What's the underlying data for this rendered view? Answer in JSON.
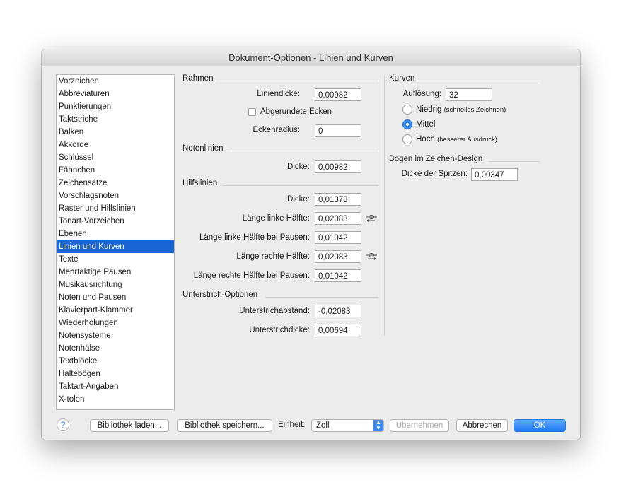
{
  "window": {
    "title": "Dokument-Optionen - Linien und Kurven"
  },
  "sidebar": {
    "items": [
      {
        "label": "Vorzeichen"
      },
      {
        "label": "Abbreviaturen"
      },
      {
        "label": "Punktierungen"
      },
      {
        "label": "Taktstriche"
      },
      {
        "label": "Balken"
      },
      {
        "label": "Akkorde"
      },
      {
        "label": "Schlüssel"
      },
      {
        "label": "Fähnchen"
      },
      {
        "label": "Zeichensätze"
      },
      {
        "label": "Vorschlagsnoten"
      },
      {
        "label": "Raster und Hilfslinien"
      },
      {
        "label": "Tonart-Vorzeichen"
      },
      {
        "label": "Ebenen"
      },
      {
        "label": "Linien und Kurven",
        "selected": true
      },
      {
        "label": "Texte"
      },
      {
        "label": "Mehrtaktige Pausen"
      },
      {
        "label": "Musikausrichtung"
      },
      {
        "label": "Noten und Pausen"
      },
      {
        "label": "Klavierpart-Klammer"
      },
      {
        "label": "Wiederholungen"
      },
      {
        "label": "Notensysteme"
      },
      {
        "label": "Notenhälse"
      },
      {
        "label": "Textblöcke"
      },
      {
        "label": "Haltebögen"
      },
      {
        "label": "Taktart-Angaben"
      },
      {
        "label": "X-tolen"
      }
    ]
  },
  "rahmen": {
    "title": "Rahmen",
    "liniendicke_label": "Liniendicke:",
    "liniendicke_value": "0,00982",
    "abgerundete_label": "Abgerundete Ecken",
    "abgerundete_checked": false,
    "eckenradius_label": "Eckenradius:",
    "eckenradius_value": "0"
  },
  "notenlinien": {
    "title": "Notenlinien",
    "dicke_label": "Dicke:",
    "dicke_value": "0,00982"
  },
  "hilfslinien": {
    "title": "Hilfslinien",
    "dicke_label": "Dicke:",
    "dicke_value": "0,01378",
    "links_label": "Länge linke Hälfte:",
    "links_value": "0,02083",
    "links_pausen_label": "Länge linke Hälfte bei Pausen:",
    "links_pausen_value": "0,01042",
    "rechts_label": "Länge rechte Hälfte:",
    "rechts_value": "0,02083",
    "rechts_pausen_label": "Länge rechte Hälfte bei Pausen:",
    "rechts_pausen_value": "0,01042"
  },
  "unterstrich": {
    "title": "Unterstrich-Optionen",
    "abstand_label": "Unterstrichabstand:",
    "abstand_value": "-0,02083",
    "dicke_label": "Unterstrichdicke:",
    "dicke_value": "0,00694"
  },
  "kurven": {
    "title": "Kurven",
    "aufloesung_label": "Auflösung:",
    "aufloesung_value": "32",
    "options": [
      {
        "label": "Niedrig",
        "note": "(schnelles Zeichnen)",
        "selected": false
      },
      {
        "label": "Mittel",
        "note": "",
        "selected": true
      },
      {
        "label": "Hoch",
        "note": "(besserer Ausdruck)",
        "selected": false
      }
    ]
  },
  "bogen": {
    "title": "Bogen im Zeichen-Design",
    "spitzen_label": "Dicke der Spitzen:",
    "spitzen_value": "0,00347"
  },
  "footer": {
    "help": "?",
    "load_label": "Bibliothek laden...",
    "save_label": "Bibliothek speichern...",
    "einheit_label": "Einheit:",
    "einheit_value": "Zoll",
    "apply_label": "Übernehmen",
    "cancel_label": "Abbrechen",
    "ok_label": "OK"
  },
  "colors": {
    "selection": "#1a65d6",
    "accent": "#2f86ef"
  }
}
